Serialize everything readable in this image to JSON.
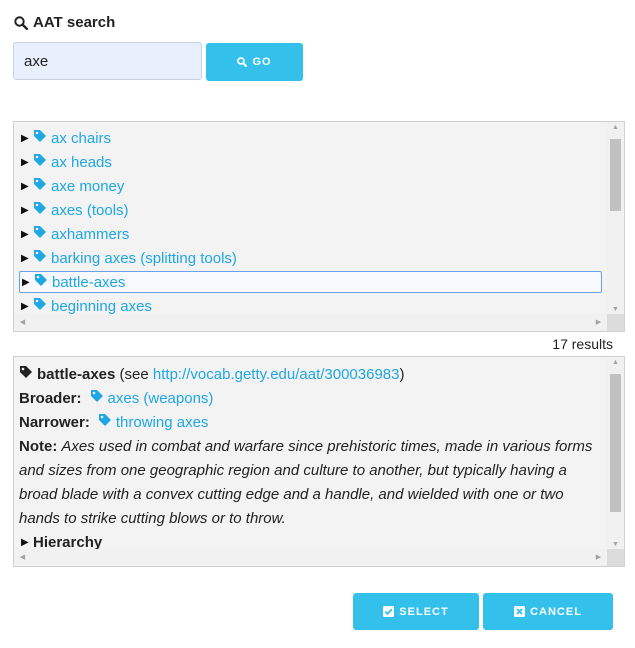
{
  "header": {
    "title": "AAT search",
    "icon": "search-icon"
  },
  "search": {
    "value": "axe",
    "go_label": "GO"
  },
  "tree": {
    "items": [
      {
        "label": "ax chairs"
      },
      {
        "label": "ax heads"
      },
      {
        "label": "axe money"
      },
      {
        "label": "axes (tools)"
      },
      {
        "label": "axhammers"
      },
      {
        "label": "barking axes (splitting tools)"
      },
      {
        "label": "battle-axes",
        "selected": true
      },
      {
        "label": "beginning axes"
      }
    ]
  },
  "results": {
    "count_label": "17 results"
  },
  "detail": {
    "term": "battle-axes",
    "see_prefix": "(see ",
    "url": "http://vocab.getty.edu/aat/300036983",
    "see_suffix": ")",
    "broader_label": "Broader:",
    "broader_term": "axes (weapons)",
    "narrower_label": "Narrower:",
    "narrower_term": "throwing axes",
    "note_label": "Note:",
    "note_lines": [
      "Axes used in combat and warfare since prehistoric times, made in various forms",
      "and sizes from one geographic region and culture to another, but typically having a",
      "broad blade with a convex cutting edge and a handle, and wielded with one or two",
      "hands to strike cutting blows or to throw."
    ],
    "hierarchy_label": "Hierarchy"
  },
  "buttons": {
    "select_label": "SELECT",
    "cancel_label": "CANCEL"
  },
  "colors": {
    "accent": "#33c1ec",
    "link": "#1ea7e4",
    "selection_border": "#6aa2e8"
  }
}
